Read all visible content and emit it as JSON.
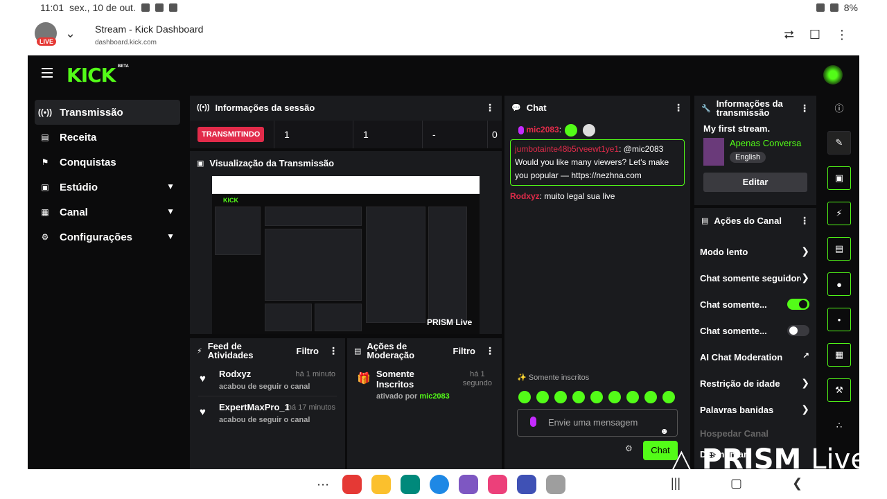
{
  "status_bar": {
    "time": "11:01",
    "date": "sex., 10 de out.",
    "battery": "8%"
  },
  "browser": {
    "live_badge": "LIVE",
    "title": "Stream - Kick Dashboard",
    "url": "dashboard.kick.com"
  },
  "app": {
    "logo": "KICK",
    "beta": "BETA"
  },
  "sidebar": {
    "items": [
      {
        "label": "Transmissão"
      },
      {
        "label": "Receita"
      },
      {
        "label": "Conquistas"
      },
      {
        "label": "Estúdio"
      },
      {
        "label": "Canal"
      },
      {
        "label": "Configurações"
      }
    ]
  },
  "session": {
    "title": "Informações da sessão",
    "status": "TRANSMITINDO",
    "stats": [
      "1",
      "1",
      "-",
      "0"
    ]
  },
  "preview": {
    "title": "Visualização da Transmissão",
    "overlay": "PRISM Live"
  },
  "feed": {
    "title_1": "Feed de",
    "title_2": "Atividades",
    "filter": "Filtro",
    "items": [
      {
        "name": "Rodxyz",
        "sub": "acabou de seguir o canal",
        "time": "há 1 minuto"
      },
      {
        "name": "ExpertMaxPro_1",
        "sub": "acabou de seguir o canal",
        "time": "há 17 minutos"
      }
    ]
  },
  "moderation": {
    "title_1": "Ações de",
    "title_2": "Moderação",
    "filter": "Filtro",
    "item": {
      "name_1": "Somente",
      "name_2": "Inscritos",
      "time_1": "há 1",
      "time_2": "segundo",
      "sub": "ativado por",
      "by": "mic2083"
    }
  },
  "chat": {
    "title": "Chat",
    "first_user": "mic2083",
    "highlight_user": "jumbotainte48b5rveewt1ye1",
    "highlight_text": ": @mic2083 Would you like many viewers? Let's make you popular — https://nezhna.com",
    "second_user": "Rodxyz",
    "second_text": ": muito legal sua live",
    "mode_label": "Somente inscritos",
    "input_placeholder": "Envie uma mensagem",
    "send": "Chat"
  },
  "stream_info": {
    "title_1": "Informações da",
    "title_2": "transmissão",
    "stream_title": "My first stream.",
    "category": "Apenas Conversa",
    "language": "English",
    "edit": "Editar"
  },
  "channel_actions": {
    "title": "Ações do Canal",
    "rows": [
      {
        "label": "Modo lento"
      },
      {
        "label": "Chat somente seguidores"
      },
      {
        "label": "Chat somente..."
      },
      {
        "label": "Chat somente..."
      },
      {
        "label": "AI Chat Moderation"
      },
      {
        "label": "Restrição de idade"
      },
      {
        "label": "Palavras banidas"
      },
      {
        "label": "Hospedar Canal"
      },
      {
        "label": "Desmontar"
      }
    ]
  },
  "watermark": {
    "brand": "PRISM",
    "suffix": "Live"
  },
  "colors": {
    "kick_green": "#53fc18",
    "live_red": "#e22b4a",
    "chat_user": "#e22b4a",
    "background": "#0b0b0c",
    "panel": "#1a1b1e"
  }
}
